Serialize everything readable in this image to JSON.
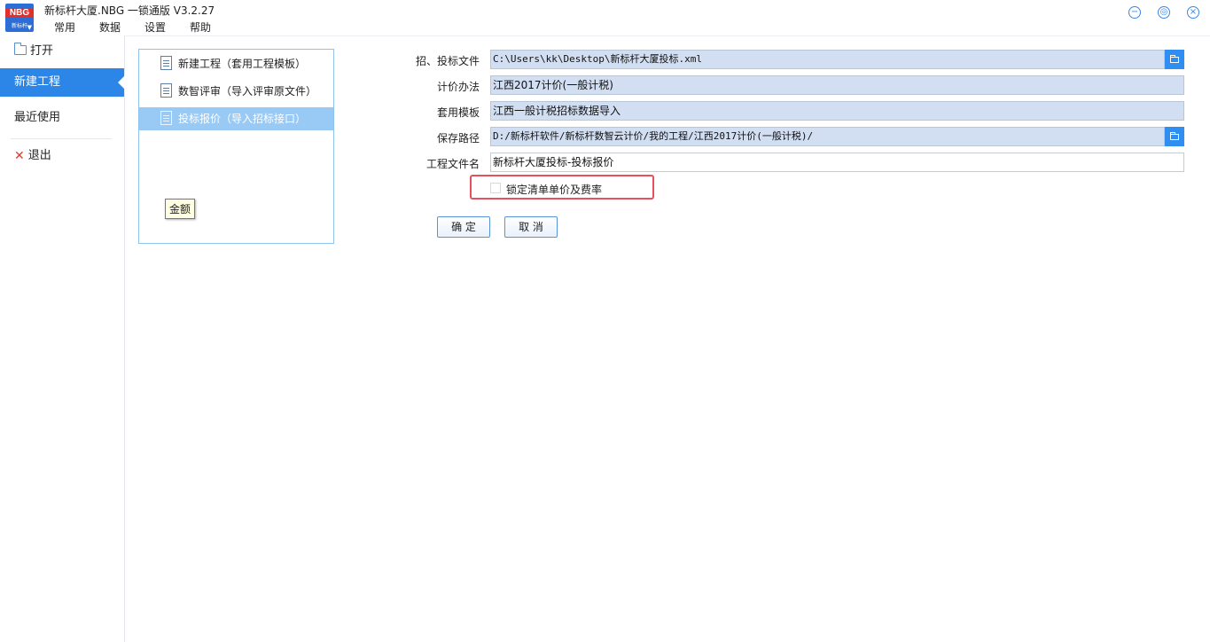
{
  "app": {
    "logo_text": "NBG",
    "logo_sub": "新标杆",
    "title": "新标杆大厦.NBG 一锁通版 V3.2.27"
  },
  "menu": [
    "常用",
    "数据",
    "设置",
    "帮助"
  ],
  "window_controls": {
    "minimize_glyph": "−",
    "restore_glyph": "◎",
    "close_glyph": "×"
  },
  "sidenav": {
    "open": "打开",
    "new_project": "新建工程",
    "recent": "最近使用",
    "exit": "退出"
  },
  "templates": {
    "items": [
      {
        "label": "新建工程（套用工程模板）"
      },
      {
        "label": "数智评审（导入评审原文件）"
      },
      {
        "label": "投标报价（导入招标接口）"
      }
    ],
    "selected_index": 2,
    "tooltip": "金额"
  },
  "form": {
    "tender_file": {
      "label": "招、投标文件",
      "value": "C:\\Users\\kk\\Desktop\\新标杆大厦投标.xml"
    },
    "pricing_method": {
      "label": "计价办法",
      "value": "江西2017计价(一般计税)"
    },
    "template": {
      "label": "套用模板",
      "value": "江西一般计税招标数据导入"
    },
    "save_path": {
      "label": "保存路径",
      "value": "D:/新标杆软件/新标杆数智云计价/我的工程/江西2017计价(一般计税)/"
    },
    "project_file_name": {
      "label": "工程文件名",
      "value": "新标杆大厦投标-投标报价"
    },
    "lock_checkbox": {
      "label": "锁定清单单价及费率",
      "checked": false
    },
    "ok_button": "确 定",
    "cancel_button": "取 消"
  },
  "colors": {
    "accent": "#2b86e8",
    "selected_row": "#99c9f5",
    "field_readonly": "#d2dff2",
    "highlight": "#e8505b"
  }
}
